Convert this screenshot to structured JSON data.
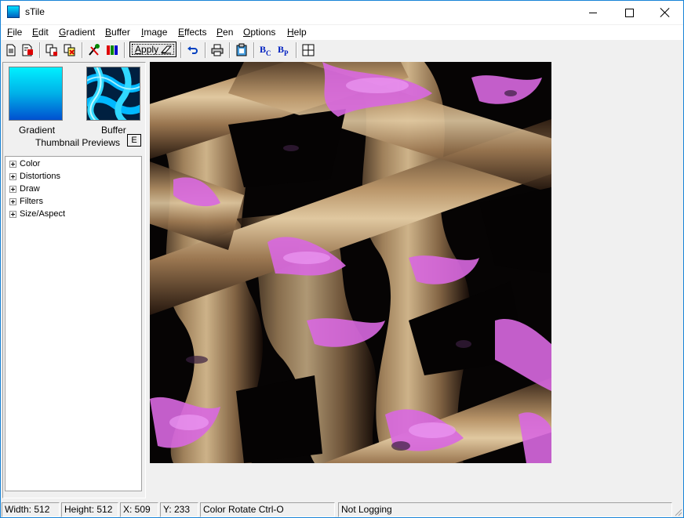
{
  "window": {
    "title": "sTile"
  },
  "menu": [
    {
      "underline": "F",
      "rest": "ile"
    },
    {
      "underline": "E",
      "rest": "dit"
    },
    {
      "underline": "G",
      "rest": "radient"
    },
    {
      "underline": "B",
      "rest": "uffer"
    },
    {
      "underline": "I",
      "rest": "mage"
    },
    {
      "underline": "E",
      "rest": "ffects"
    },
    {
      "underline": "P",
      "rest": "en"
    },
    {
      "underline": "O",
      "rest": "ptions"
    },
    {
      "underline": "H",
      "rest": "elp"
    }
  ],
  "toolbar": {
    "apply_label_underline": "A",
    "apply_label_rest": "pply",
    "buttons": [
      "new-icon",
      "save-icon",
      "copy-icon",
      "paste-icon",
      "tools-icon",
      "palette-icon",
      "undo-icon",
      "print-icon",
      "clipboard-icon",
      "blur-c-icon",
      "blur-p-icon",
      "grid-icon"
    ]
  },
  "thumbnails": {
    "gradient_label": "Gradient",
    "buffer_label": "Buffer",
    "caption": "Thumbnail Previews",
    "edit_button": "E"
  },
  "tree": {
    "items": [
      "Color",
      "Distortions",
      "Draw",
      "Filters",
      "Size/Aspect"
    ]
  },
  "status": {
    "width": "Width: 512",
    "height": "Height: 512",
    "x": "X: 509",
    "y": "Y: 233",
    "command": "Color Rotate Ctrl-O",
    "logging": "Not Logging"
  },
  "colors": {
    "accent_border": "#1883d7",
    "texture_pink": "#e060e8",
    "texture_tan": "#c8a878",
    "texture_dark": "#050303"
  }
}
